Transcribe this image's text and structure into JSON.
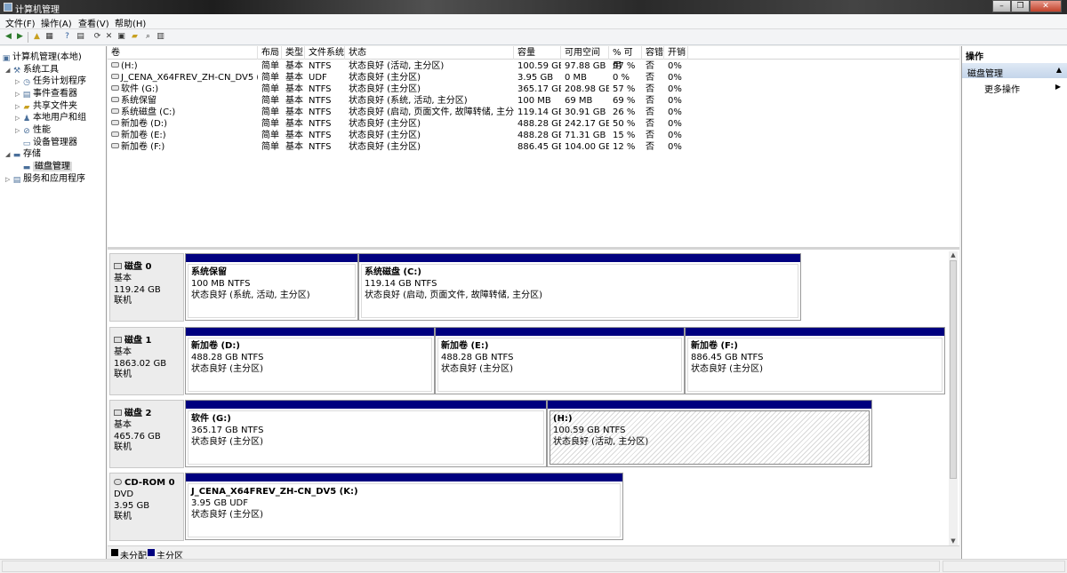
{
  "window": {
    "title": "计算机管理"
  },
  "menu": [
    "文件(F)",
    "操作(A)",
    "查看(V)",
    "帮助(H)"
  ],
  "toolbar": [
    "back-icon",
    "forward-icon",
    "up-folder-icon",
    "show-tree-icon",
    "help-icon",
    "properties-icon",
    "close-icon",
    "delete-icon",
    "open-icon",
    "search-icon",
    "refresh-icon"
  ],
  "tree": [
    {
      "label": "计算机管理(本地)",
      "icon": "computer-management-icon"
    },
    {
      "label": "系统工具",
      "icon": "tools-icon"
    },
    {
      "label": "任务计划程序",
      "icon": "task-scheduler-icon"
    },
    {
      "label": "事件查看器",
      "icon": "event-viewer-icon"
    },
    {
      "label": "共享文件夹",
      "icon": "shared-folder-icon"
    },
    {
      "label": "本地用户和组",
      "icon": "users-icon"
    },
    {
      "label": "性能",
      "icon": "performance-icon"
    },
    {
      "label": "设备管理器",
      "icon": "device-manager-icon"
    },
    {
      "label": "存储",
      "icon": "storage-icon"
    },
    {
      "label": "磁盘管理",
      "icon": "disk-management-icon"
    },
    {
      "label": "服务和应用程序",
      "icon": "services-icon"
    }
  ],
  "list": {
    "columns": [
      "卷",
      "布局",
      "类型",
      "文件系统",
      "状态",
      "容量",
      "可用空间",
      "% 可用",
      "容错",
      "开销"
    ],
    "rows": [
      [
        "(H:)",
        "简单",
        "基本",
        "NTFS",
        "状态良好 (活动, 主分区)",
        "100.59 GB",
        "97.88 GB",
        "97 %",
        "否",
        "0%"
      ],
      [
        "J_CENA_X64FREV_ZH-CN_DV5 (K:)",
        "简单",
        "基本",
        "UDF",
        "状态良好 (主分区)",
        "3.95 GB",
        "0 MB",
        "0 %",
        "否",
        "0%"
      ],
      [
        "软件 (G:)",
        "简单",
        "基本",
        "NTFS",
        "状态良好 (主分区)",
        "365.17 GB",
        "208.98 GB",
        "57 %",
        "否",
        "0%"
      ],
      [
        "系统保留",
        "简单",
        "基本",
        "NTFS",
        "状态良好 (系统, 活动, 主分区)",
        "100 MB",
        "69 MB",
        "69 %",
        "否",
        "0%"
      ],
      [
        "系统磁盘 (C:)",
        "简单",
        "基本",
        "NTFS",
        "状态良好 (启动, 页面文件, 故障转储, 主分区)",
        "119.14 GB",
        "30.91 GB",
        "26 %",
        "否",
        "0%"
      ],
      [
        "新加卷 (D:)",
        "简单",
        "基本",
        "NTFS",
        "状态良好 (主分区)",
        "488.28 GB",
        "242.17 GB",
        "50 %",
        "否",
        "0%"
      ],
      [
        "新加卷 (E:)",
        "简单",
        "基本",
        "NTFS",
        "状态良好 (主分区)",
        "488.28 GB",
        "71.31 GB",
        "15 %",
        "否",
        "0%"
      ],
      [
        "新加卷 (F:)",
        "简单",
        "基本",
        "NTFS",
        "状态良好 (主分区)",
        "886.45 GB",
        "104.00 GB",
        "12 %",
        "否",
        "0%"
      ]
    ]
  },
  "disks": [
    {
      "name": "磁盘 0",
      "type": "基本",
      "size": "119.24 GB",
      "status": "联机",
      "partitions": [
        {
          "name": "系统保留",
          "size": "100 MB NTFS",
          "status": "状态良好 (系统, 活动, 主分区)"
        },
        {
          "name": "系统磁盘  (C:)",
          "size": "119.14 GB NTFS",
          "status": "状态良好 (启动, 页面文件, 故障转储, 主分区)"
        }
      ]
    },
    {
      "name": "磁盘 1",
      "type": "基本",
      "size": "1863.02 GB",
      "status": "联机",
      "partitions": [
        {
          "name": "新加卷  (D:)",
          "size": "488.28 GB NTFS",
          "status": "状态良好 (主分区)"
        },
        {
          "name": "新加卷  (E:)",
          "size": "488.28 GB NTFS",
          "status": "状态良好 (主分区)"
        },
        {
          "name": "新加卷  (F:)",
          "size": "886.45 GB NTFS",
          "status": "状态良好 (主分区)"
        }
      ]
    },
    {
      "name": "磁盘 2",
      "type": "基本",
      "size": "465.76 GB",
      "status": "联机",
      "partitions": [
        {
          "name": "软件  (G:)",
          "size": "365.17 GB NTFS",
          "status": "状态良好 (主分区)"
        },
        {
          "name": "(H:)",
          "size": "100.59 GB NTFS",
          "status": "状态良好 (活动, 主分区)"
        }
      ]
    },
    {
      "name": "CD-ROM 0",
      "type": "DVD",
      "size": "3.95 GB",
      "status": "联机",
      "partitions": [
        {
          "name": "J_CENA_X64FREV_ZH-CN_DV5  (K:)",
          "size": "3.95 GB UDF",
          "status": "状态良好 (主分区)"
        }
      ]
    }
  ],
  "legend": [
    {
      "label": "未分配",
      "color": "#000000"
    },
    {
      "label": "主分区",
      "color": "#00007f"
    }
  ],
  "actions": {
    "title": "操作",
    "group": "磁盘管理",
    "more": "更多操作"
  }
}
